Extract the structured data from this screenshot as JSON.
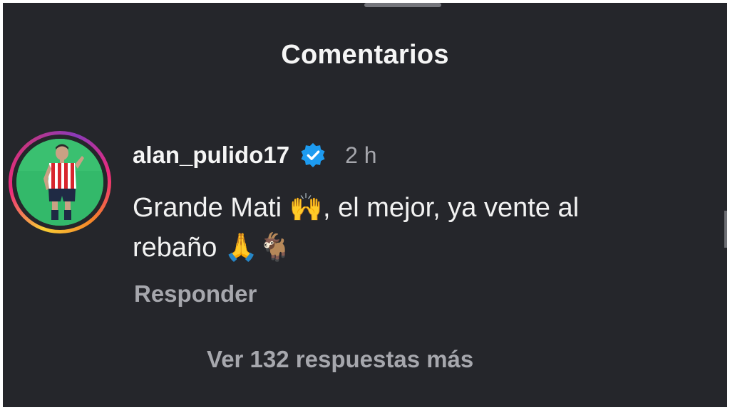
{
  "sheet": {
    "title": "Comentarios"
  },
  "comment": {
    "username": "alan_pulido17",
    "verified_icon": "verified-badge-icon",
    "time_ago": "2 h",
    "text_line_1": "Grande Mati 🙌, el mejor, ya vente al",
    "text_line_2": "rebaño 🙏🐐",
    "reply_label": "Responder",
    "view_replies_label": "Ver 132 respuestas más"
  },
  "colors": {
    "background": "#25262b",
    "primary_text": "#f5f5f5",
    "secondary_text": "#a6a7ad",
    "verified_blue": "#1d9bf0",
    "avatar_background": "#33b96a"
  }
}
